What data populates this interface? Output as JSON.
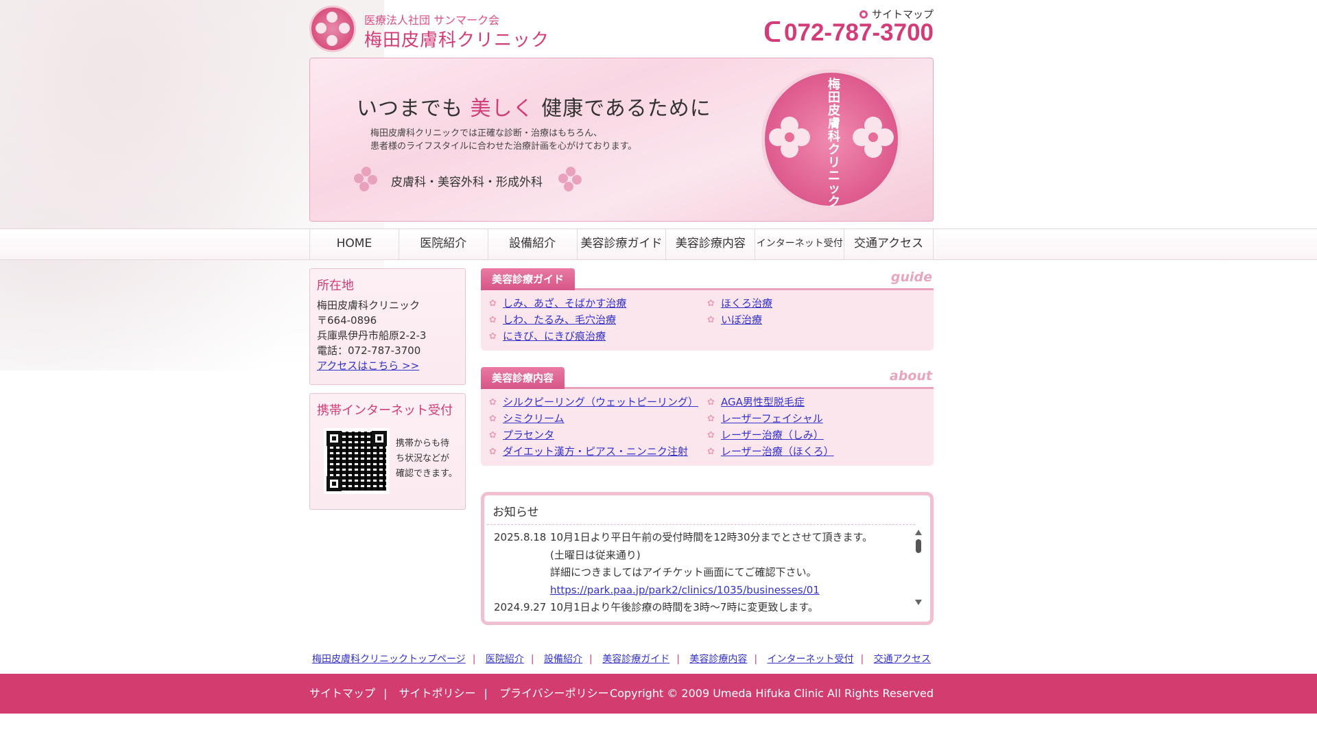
{
  "header": {
    "org": "医療法人社団 サンマーク会",
    "clinic_name": "梅田皮膚科クリニック",
    "sitemap_label": "サイトマップ",
    "phone": "072-787-3700"
  },
  "hero": {
    "title_pre": "いつまでも",
    "title_accent": "美しく",
    "title_post": "健康であるために",
    "text_line1": "梅田皮膚科クリニックでは正確な診断・治療はもちろん、",
    "text_line2": "患者様のライフスタイルに合わせた治療計画を心がけております。",
    "departments": "皮膚科・美容外科・形成外科",
    "seal_text": "梅田皮膚科クリニック"
  },
  "nav": {
    "items": [
      {
        "label": "HOME"
      },
      {
        "label": "医院紹介"
      },
      {
        "label": "設備紹介"
      },
      {
        "label": "美容診療ガイド"
      },
      {
        "label": "美容診療内容"
      },
      {
        "label": "インターネット受付"
      },
      {
        "label": "交通アクセス"
      }
    ]
  },
  "sidebar": {
    "location": {
      "title": "所在地",
      "name": "梅田皮膚科クリニック",
      "postal": "〒664-0896",
      "address": "兵庫県伊丹市船原2-2-3",
      "phone": "電話：072-787-3700",
      "access_link": "アクセスはこちら >>"
    },
    "mobile": {
      "title": "携帯インターネット受付",
      "text": "携帯からも待ち状況などが確認できます。"
    }
  },
  "guide": {
    "tab": "美容診療ガイド",
    "en": "guide",
    "links": [
      "しみ、あざ、そばかす治療",
      "ほくろ治療",
      "しわ、たるみ、毛穴治療",
      "いぼ治療",
      "にきび、にきび痕治療"
    ]
  },
  "about": {
    "tab": "美容診療内容",
    "en": "about",
    "links": [
      "シルクピーリング（ウェットピーリング）",
      "AGA男性型脱毛症",
      "シミクリーム",
      "レーザーフェイシャル",
      "プラセンタ",
      "レーザー治療（しみ）",
      "ダイエット漢方・ピアス・ニンニク注射",
      "レーザー治療（ほくろ）"
    ]
  },
  "news": {
    "title": "お知らせ",
    "entries": [
      {
        "date": "2025.8.18",
        "line1": "10月1日より平日午前の受付時間を12時30分までとさせて頂きます。",
        "line2": "(土曜日は従来通り)",
        "line3": "詳細につきましてはアイチケット画面にてご確認下さい。",
        "link": "https://park.paa.jp/park2/clinics/1035/businesses/01"
      },
      {
        "date": "2024.9.27",
        "line1": "10月1日より午後診療の時間を3時～7時に変更致します。"
      }
    ]
  },
  "footer": {
    "links": [
      "梅田皮膚科クリニックトップページ",
      "医院紹介",
      "設備紹介",
      "美容診療ガイド",
      "美容診療内容",
      "インターネット受付",
      "交通アクセス"
    ],
    "bar_links": [
      "サイトマップ",
      "サイトポリシー",
      "プライバシーポリシー"
    ],
    "copyright": "Copyright © 2009 Umeda Hifuka Clinic All Rights Reserved"
  },
  "colors": {
    "brand": "#d23c78",
    "footer_bg": "#d23c6f",
    "link": "#3333cc"
  }
}
